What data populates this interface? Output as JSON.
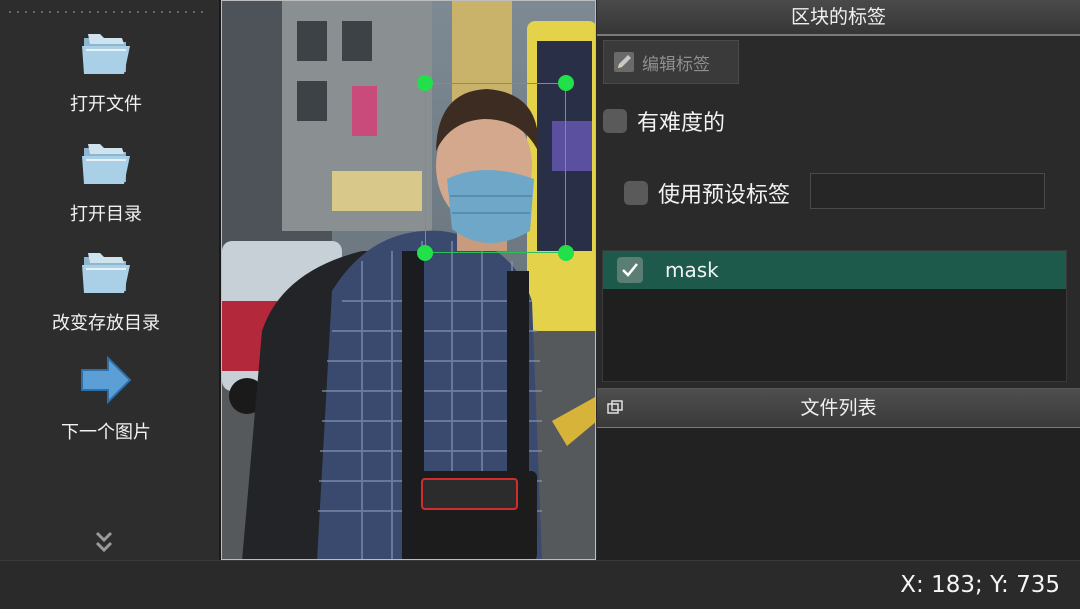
{
  "toolbar": {
    "items": [
      {
        "label": "打开文件",
        "icon": "folder-icon"
      },
      {
        "label": "打开目录",
        "icon": "folder-icon"
      },
      {
        "label": "改变存放目录",
        "icon": "folder-icon"
      },
      {
        "label": "下一个图片",
        "icon": "right-arrow-icon"
      }
    ],
    "more_icon": "double-chevron-down-icon"
  },
  "dock": {
    "title": "区块的标签",
    "edit_label": "编辑标签",
    "difficult_label": "有难度的",
    "use_default_label": "使用预设标签",
    "default_label_value": "",
    "labels": [
      {
        "text": "mask",
        "checked": true
      }
    ]
  },
  "file_list": {
    "title": "文件列表"
  },
  "status": {
    "coords": "X: 183; Y: 735"
  },
  "colors": {
    "selected_label_bg": "#1e5a4c",
    "bbox_handle": "#22e04a",
    "bbox_border": "#2fbf5a"
  }
}
